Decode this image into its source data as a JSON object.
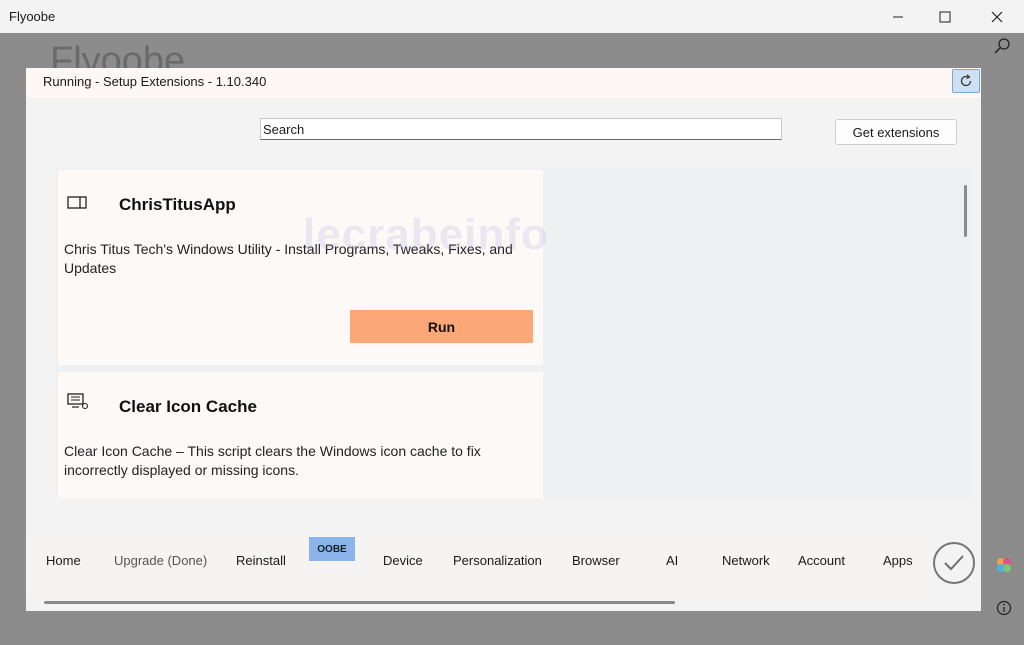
{
  "window": {
    "title": "Flyoobe",
    "controls": [
      "minimize",
      "maximize",
      "close"
    ]
  },
  "background": {
    "app_title": "Flyoobe"
  },
  "dialog": {
    "title": "Running - Setup Extensions - 1.10.340",
    "search": {
      "placeholder": "Search",
      "value": ""
    },
    "get_extensions_label": "Get extensions",
    "extensions": [
      {
        "icon": "window-panel-icon",
        "name": "ChrisTitusApp",
        "description": "Chris Titus Tech's Windows Utility - Install Programs, Tweaks, Fixes, and Updates",
        "run_label": "Run"
      },
      {
        "icon": "screen-cache-icon",
        "name": "Clear Icon Cache",
        "description": "Clear Icon Cache – This script clears the Windows icon cache to fix incorrectly displayed or missing icons."
      }
    ]
  },
  "nav": {
    "items": [
      {
        "label": "Home"
      },
      {
        "label": "Upgrade (Done)"
      },
      {
        "label": "Reinstall"
      },
      {
        "label": "Device"
      },
      {
        "label": "Personalization"
      },
      {
        "label": "Browser"
      },
      {
        "label": "AI"
      },
      {
        "label": "Network"
      },
      {
        "label": "Account"
      },
      {
        "label": "Apps"
      }
    ],
    "badge": "OOBE"
  },
  "watermark": "lecrabeinfo",
  "colors": {
    "run_button": "#fba777",
    "oobe_badge": "#8ab4ea",
    "refresh_button": "#cfe0f2"
  }
}
